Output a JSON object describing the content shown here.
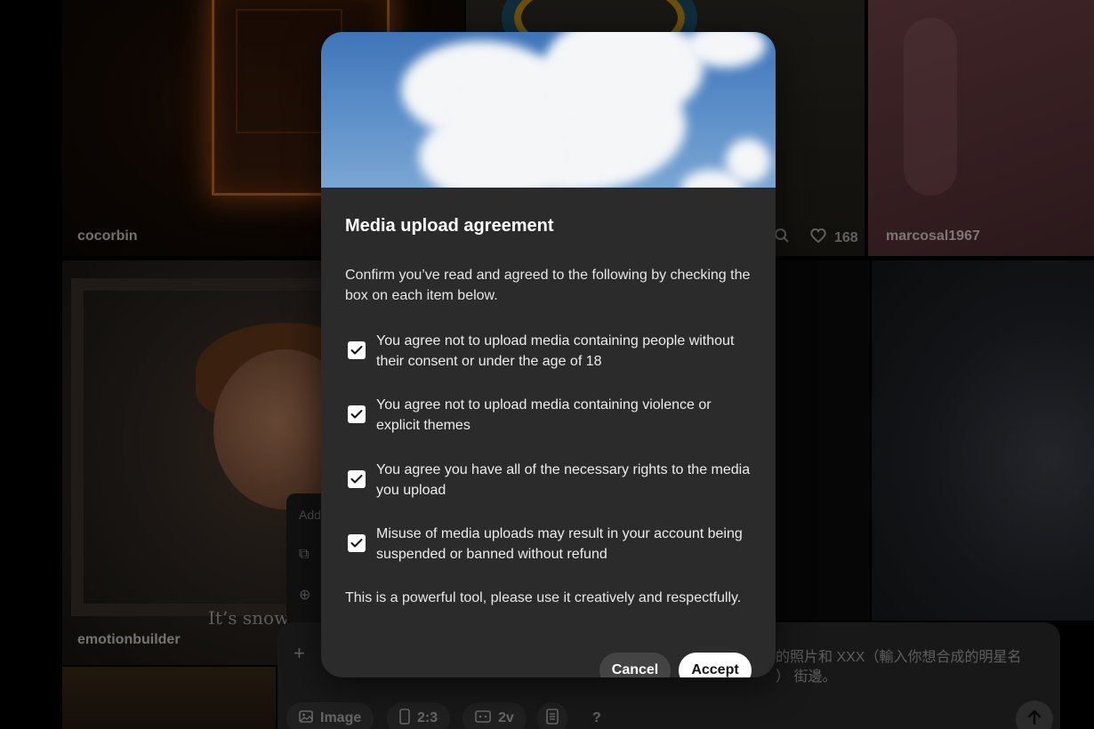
{
  "gallery": {
    "tiles": [
      {
        "username": "cocorbin"
      },
      {
        "username": "marcosal1967"
      },
      {
        "username": "emotionbuilder"
      }
    ],
    "likes_count": "168",
    "image_caption_text": "It’s snown"
  },
  "prompt_bar": {
    "side_menu_partial": "Add",
    "prompt_line_1": "的照片和 XXX（輸入你想合成的明星名",
    "prompt_line_2": "街邊。",
    "prompt_line_2_prefix": "）",
    "chips": [
      {
        "label": "Image",
        "icon": "image-icon"
      },
      {
        "label": "2:3",
        "icon": "portrait-ratio-icon"
      },
      {
        "label": "2v",
        "icon": "variations-icon"
      },
      {
        "label": "",
        "icon": "document-icon"
      },
      {
        "label": "?",
        "icon": "help-icon"
      }
    ]
  },
  "modal": {
    "title": "Media upload agreement",
    "intro": "Confirm you’ve read and agreed to the following by checking the box on each item below.",
    "items": [
      {
        "text": "You agree not to upload media containing people without their consent or under the age of 18",
        "checked": true
      },
      {
        "text": "You agree not to upload media containing violence or explicit themes",
        "checked": true
      },
      {
        "text": "You agree you have all of the necessary rights to the media you upload",
        "checked": true
      },
      {
        "text": "Misuse of media uploads may result in your account being suspended or banned without refund",
        "checked": true
      }
    ],
    "outro": "This is a powerful tool, please use it creatively and respectfully.",
    "cancel_label": "Cancel",
    "accept_label": "Accept"
  },
  "colors": {
    "modal_bg": "#2b2b2b",
    "accept_bg": "#ffffff",
    "cancel_bg": "#444444"
  }
}
